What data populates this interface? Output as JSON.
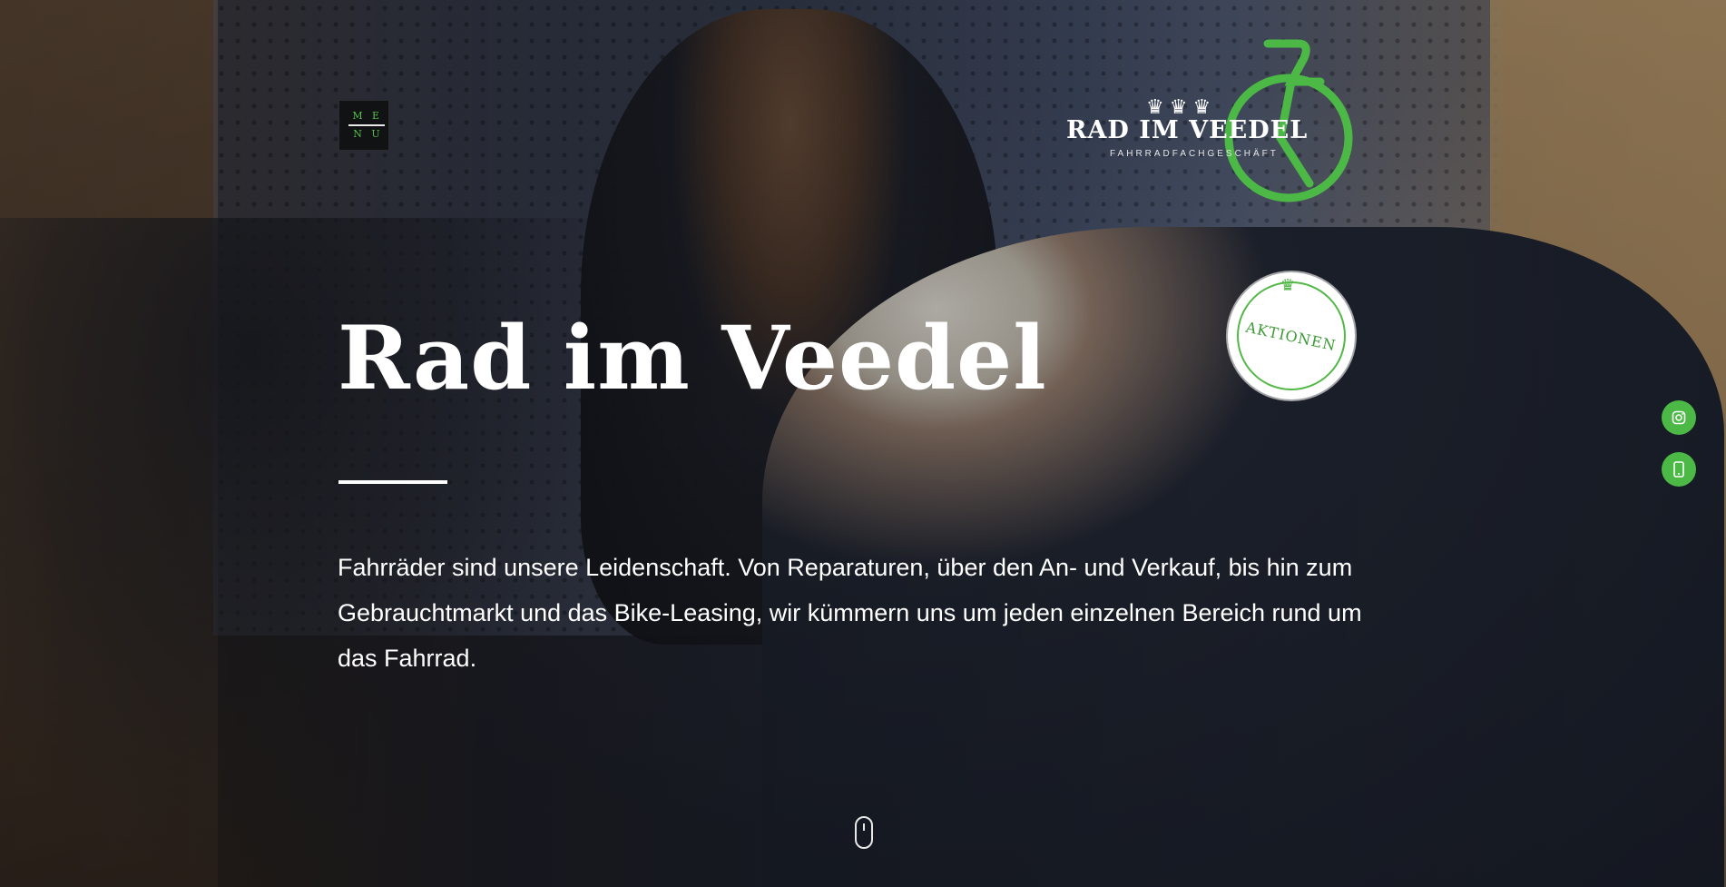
{
  "menu": {
    "letters": [
      "M",
      "E",
      "N",
      "U"
    ]
  },
  "logo": {
    "wordmark": "RAD IM VEEDEL",
    "subtitle": "FAHRRADFACHGESCHÄFT",
    "crowns": "♛♛♛",
    "accent_color": "#4cb846"
  },
  "badge": {
    "label": "AKTIONEN",
    "icon": "crown-icon"
  },
  "hero": {
    "title": "Rad im Veedel",
    "intro": "Fahrräder sind unsere Leidenschaft. Von Reparaturen, über den An- und Verkauf, bis hin zum Gebrauchtmarkt und das Bike-Leasing, wir kümmern uns um jeden einzelnen Bereich rund um das Fahrrad."
  },
  "side_buttons": [
    {
      "icon": "instagram-icon"
    },
    {
      "icon": "phone-icon"
    }
  ],
  "scroll_indicator": {
    "icon": "mouse-scroll-icon"
  }
}
